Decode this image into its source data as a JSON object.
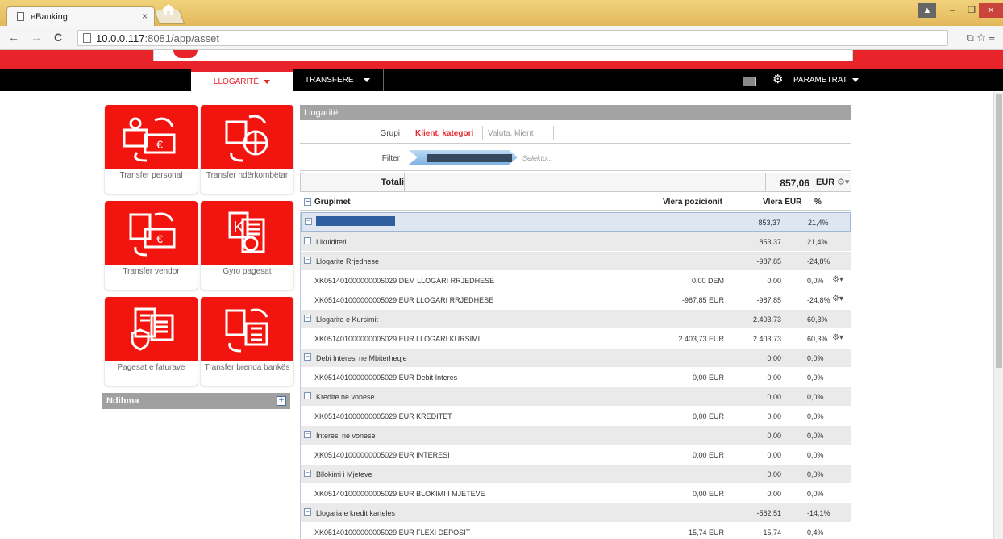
{
  "browser": {
    "tab_title": "eBanking",
    "tab_close": "×",
    "url_host": "10.0.0.117",
    "url_path": ":8081/app/asset",
    "back": "←",
    "forward": "→",
    "reload": "C",
    "right_icons": "⧉☆≡",
    "win_min": "–",
    "win_max": "❐",
    "win_close": "×"
  },
  "nav": {
    "home_icon": "home-icon",
    "tab_accounts": "LLOGARITË",
    "tab_transfers": "TRANSFERET",
    "params": "PARAMETRAT"
  },
  "tiles": [
    {
      "label": "Transfer personal",
      "icon": "person-transfer-icon"
    },
    {
      "label": "Transfer ndërkombëtar",
      "icon": "international-transfer-icon"
    },
    {
      "label": "Transfer vendor",
      "icon": "domestic-transfer-icon"
    },
    {
      "label": "Gyro pagesat",
      "icon": "giro-payment-icon"
    },
    {
      "label": "Pagesat e faturave",
      "icon": "bill-payment-icon"
    },
    {
      "label": "Transfer brenda bankës",
      "icon": "internal-transfer-icon"
    }
  ],
  "help": {
    "label": "Ndihma",
    "plus": "+"
  },
  "panel": {
    "title": "Llogaritë",
    "grupi_label": "Grupi",
    "grupi_active": "Klient, kategori",
    "grupi_other": "Valuta, klient",
    "filter_label": "Filter",
    "filter_select": "Selekto...",
    "total_label": "Totali",
    "total_value": "857,06",
    "total_currency": "EUR",
    "col_groups": "Grupimet",
    "col_position": "Vlera pozicionit",
    "col_eur": "Vlera EUR",
    "col_pct": "%"
  },
  "rows": [
    {
      "type": "sel",
      "name": "",
      "pos": "",
      "eur": "853,37",
      "pct": "21,4%"
    },
    {
      "type": "grp",
      "name": "Likuiditeti",
      "pos": "",
      "eur": "853,37",
      "pct": "21,4%"
    },
    {
      "type": "grp",
      "name": "Llogarite Rrjedhese",
      "pos": "",
      "eur": "-987,85",
      "pct": "-24,8%"
    },
    {
      "type": "acc",
      "name": "XK051401000000005029 DEM LLOGARI RRJEDHESE",
      "pos": "0,00 DEM",
      "eur": "0,00",
      "pct": "0,0%",
      "gear": true
    },
    {
      "type": "acc",
      "name": "XK051401000000005029 EUR LLOGARI RRJEDHESE",
      "pos": "-987,85 EUR",
      "eur": "-987,85",
      "pct": "-24,8%",
      "gear": true
    },
    {
      "type": "grp",
      "name": "Llogarite e Kursimit",
      "pos": "",
      "eur": "2.403,73",
      "pct": "60,3%"
    },
    {
      "type": "acc",
      "name": "XK051401000000005029 EUR LLOGARI KURSIMI",
      "pos": "2.403,73 EUR",
      "eur": "2.403,73",
      "pct": "60,3%",
      "gear": true
    },
    {
      "type": "grp",
      "name": "Debi Interesi ne Mbiterheqje",
      "pos": "",
      "eur": "0,00",
      "pct": "0,0%"
    },
    {
      "type": "acc",
      "name": "XK051401000000005029 EUR Debit Interes",
      "pos": "0,00 EUR",
      "eur": "0,00",
      "pct": "0,0%"
    },
    {
      "type": "grp",
      "name": "Kredite ne vonese",
      "pos": "",
      "eur": "0,00",
      "pct": "0,0%"
    },
    {
      "type": "acc",
      "name": "XK051401000000005029 EUR KREDITET",
      "pos": "0,00 EUR",
      "eur": "0,00",
      "pct": "0,0%"
    },
    {
      "type": "grp",
      "name": "Interesi ne vonese",
      "pos": "",
      "eur": "0,00",
      "pct": "0,0%"
    },
    {
      "type": "acc",
      "name": "XK051401000000005029 EUR INTERESI",
      "pos": "0,00 EUR",
      "eur": "0,00",
      "pct": "0,0%"
    },
    {
      "type": "grp",
      "name": "Bllokimi i Mjeteve",
      "pos": "",
      "eur": "0,00",
      "pct": "0,0%"
    },
    {
      "type": "acc",
      "name": "XK051401000000005029 EUR BLOKIMI I MJETEVE",
      "pos": "0,00 EUR",
      "eur": "0,00",
      "pct": "0,0%"
    },
    {
      "type": "grp",
      "name": "Llogaria e kredit karteles",
      "pos": "",
      "eur": "-562,51",
      "pct": "-14,1%"
    },
    {
      "type": "acc",
      "name": "XK051401000000005029 EUR FLEXI DEPOSIT",
      "pos": "15,74 EUR",
      "eur": "15,74",
      "pct": "0,4%"
    }
  ],
  "colors": {
    "brand_red": "#e8232a",
    "nav_black": "#000000",
    "group_grey": "#eaeaea",
    "selected_blue": "#dde6f1"
  }
}
